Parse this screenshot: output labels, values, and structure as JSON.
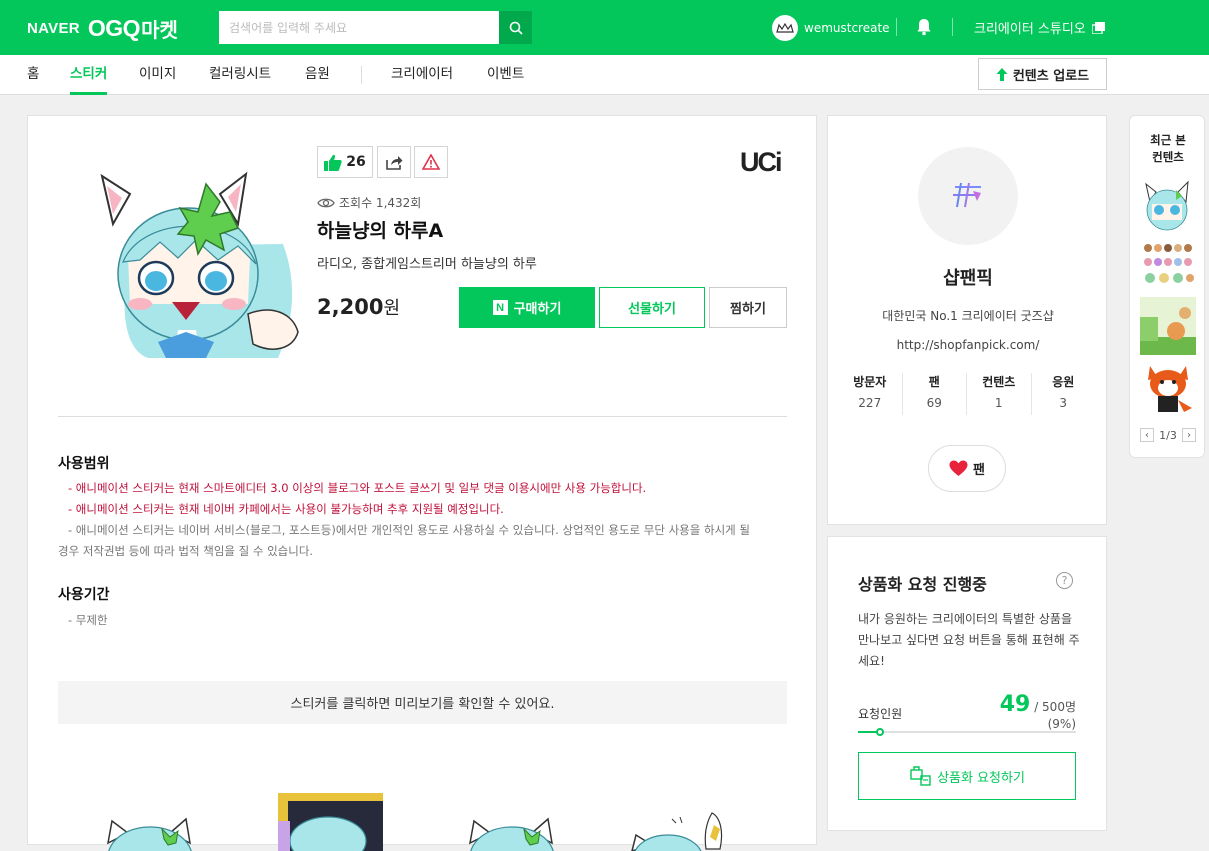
{
  "header": {
    "logo_naver": "NAVER",
    "logo_ogq": "OGQ",
    "logo_market": "마켓",
    "search_placeholder": "검색어를 입력해 주세요",
    "username": "wemustcreate",
    "studio_label": "크리에이터 스튜디오"
  },
  "nav": {
    "items": [
      {
        "label": "홈"
      },
      {
        "label": "스티커"
      },
      {
        "label": "이미지"
      },
      {
        "label": "컬러링시트"
      },
      {
        "label": "음원"
      },
      {
        "label": "크리에이터"
      },
      {
        "label": "이벤트"
      }
    ],
    "active": "스티커",
    "upload_label": "컨텐츠 업로드"
  },
  "product": {
    "likes": "26",
    "brand": "UCi",
    "views": "조회수 1,432회",
    "title": "하늘냥의 하루A",
    "description": "라디오, 종합게임스트리머 하늘냥의 하루",
    "price": "2,200",
    "price_unit": "원",
    "buy_label": "구매하기",
    "gift_label": "선물하기",
    "wish_label": "찜하기"
  },
  "usage": {
    "scope_title": "사용범위",
    "scope_lines": [
      "- 애니메이션 스티커는 현재 스마트에디터 3.0 이상의 블로그와 포스트 글쓰기 및 일부 댓글 이용시에만 사용 가능합니다.",
      "- 애니메이션 스티커는 현재 네이버 카페에서는 사용이 불가능하며 추후 지원될 예정입니다.",
      "- 애니메이션 스티커는 네이버 서비스(블로그, 포스트등)에서만 개인적인 용도로 사용하실 수 있습니다. 상업적인 용도로 무단 사용을 하시게 될",
      "경우 저작권법 등에 따라 법적 책임을 질 수 있습니다."
    ],
    "period_title": "사용기간",
    "period_value": "- 무제한",
    "preview_notice": "스티커를 클릭하면 미리보기를 확인할 수 있어요."
  },
  "creator": {
    "name": "샵팬픽",
    "tagline": "대한민국 No.1 크리에이터 굿즈샵",
    "url": "http://shopfanpick.com/",
    "stats": [
      {
        "label": "방문자",
        "value": "227"
      },
      {
        "label": "팬",
        "value": "69"
      },
      {
        "label": "컨텐츠",
        "value": "1"
      },
      {
        "label": "응원",
        "value": "3"
      }
    ],
    "fan_label": "팬"
  },
  "request": {
    "title": "상품화 요청 진행중",
    "help": "?",
    "description": "내가 응원하는 크리에이터의 특별한 상품을 만나보고 싶다면 요청 버튼을 통해 표현해 주세요!",
    "count_label": "요청인원",
    "count": "49",
    "total": "/ 500명 (9%)",
    "progress_fraction": 0.1,
    "button_label": "상품화 요청하기"
  },
  "recent": {
    "title_line1": "최근 본",
    "title_line2": "컨텐츠",
    "page": "1/3"
  },
  "colors": {
    "brand_green": "#03c75a",
    "heart_red": "#e8233c",
    "warning_red": "#e0334b"
  }
}
